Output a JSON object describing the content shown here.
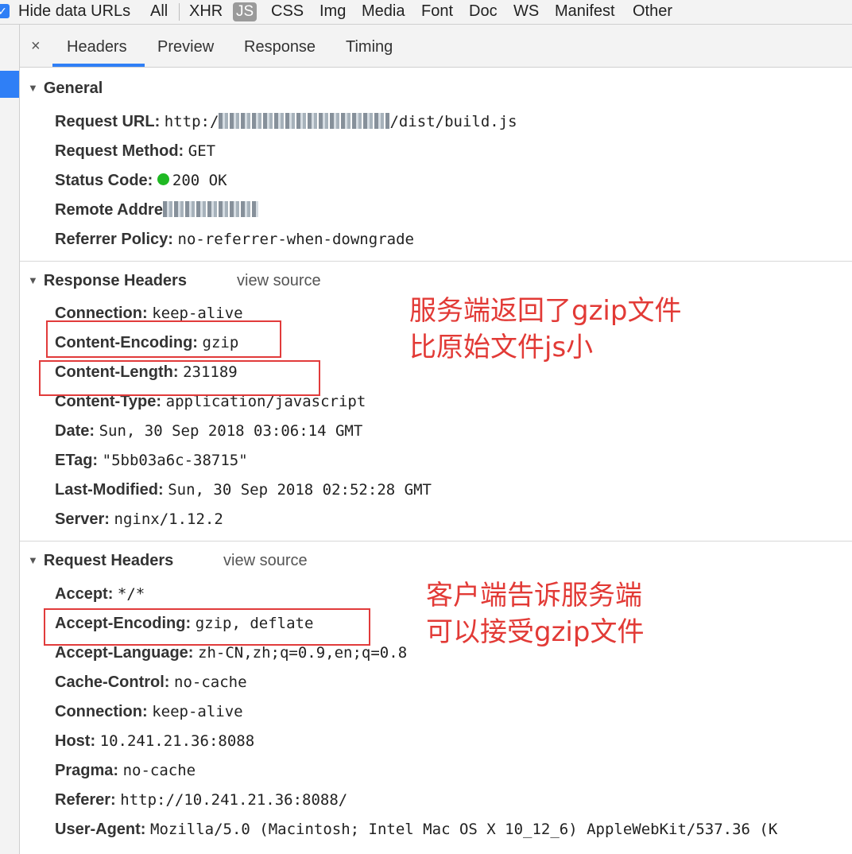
{
  "filter_bar": {
    "hide_data_urls_label": "Hide data URLs",
    "types": [
      "All",
      "XHR",
      "JS",
      "CSS",
      "Img",
      "Media",
      "Font",
      "Doc",
      "WS",
      "Manifest",
      "Other"
    ],
    "selected": "JS"
  },
  "tabs": {
    "close": "×",
    "items": [
      "Headers",
      "Preview",
      "Response",
      "Timing"
    ],
    "active": "Headers"
  },
  "general": {
    "title": "General",
    "request_url_key": "Request URL:",
    "request_url_value": "/dist/build.js",
    "request_url_prefix": "http:/",
    "request_method_key": "Request Method:",
    "request_method_value": "GET",
    "status_code_key": "Status Code:",
    "status_code_value": "200 OK",
    "remote_address_key": "Remote Addre",
    "referrer_policy_key": "Referrer Policy:",
    "referrer_policy_value": "no-referrer-when-downgrade"
  },
  "response_headers": {
    "title": "Response Headers",
    "view_source": "view source",
    "rows": [
      {
        "k": "Connection:",
        "v": "keep-alive"
      },
      {
        "k": "Content-Encoding:",
        "v": "gzip"
      },
      {
        "k": "Content-Length:",
        "v": "231189"
      },
      {
        "k": "Content-Type:",
        "v": "application/javascript"
      },
      {
        "k": "Date:",
        "v": "Sun, 30 Sep 2018 03:06:14 GMT"
      },
      {
        "k": "ETag:",
        "v": "\"5bb03a6c-38715\""
      },
      {
        "k": "Last-Modified:",
        "v": "Sun, 30 Sep 2018 02:52:28 GMT"
      },
      {
        "k": "Server:",
        "v": "nginx/1.12.2"
      }
    ]
  },
  "request_headers": {
    "title": "Request Headers",
    "view_source": "view source",
    "rows": [
      {
        "k": "Accept:",
        "v": "*/*"
      },
      {
        "k": "Accept-Encoding:",
        "v": "gzip, deflate"
      },
      {
        "k": "Accept-Language:",
        "v": "zh-CN,zh;q=0.9,en;q=0.8"
      },
      {
        "k": "Cache-Control:",
        "v": "no-cache"
      },
      {
        "k": "Connection:",
        "v": "keep-alive"
      },
      {
        "k": "Host:",
        "v": "10.241.21.36:8088"
      },
      {
        "k": "Pragma:",
        "v": "no-cache"
      },
      {
        "k": "Referer:",
        "v": "http://10.241.21.36:8088/"
      },
      {
        "k": "User-Agent:",
        "v": "Mozilla/5.0 (Macintosh; Intel Mac OS X 10_12_6) AppleWebKit/537.36 (K"
      }
    ]
  },
  "annotations": {
    "server_line1": "服务端返回了gzip文件",
    "server_line2": "比原始文件js小",
    "client_line1": "客户端告诉服务端",
    "client_line2": "可以接受gzip文件"
  },
  "colors": {
    "accent": "#2f7ff6",
    "annotation_red": "#e23a36",
    "status_green": "#1fb923"
  }
}
